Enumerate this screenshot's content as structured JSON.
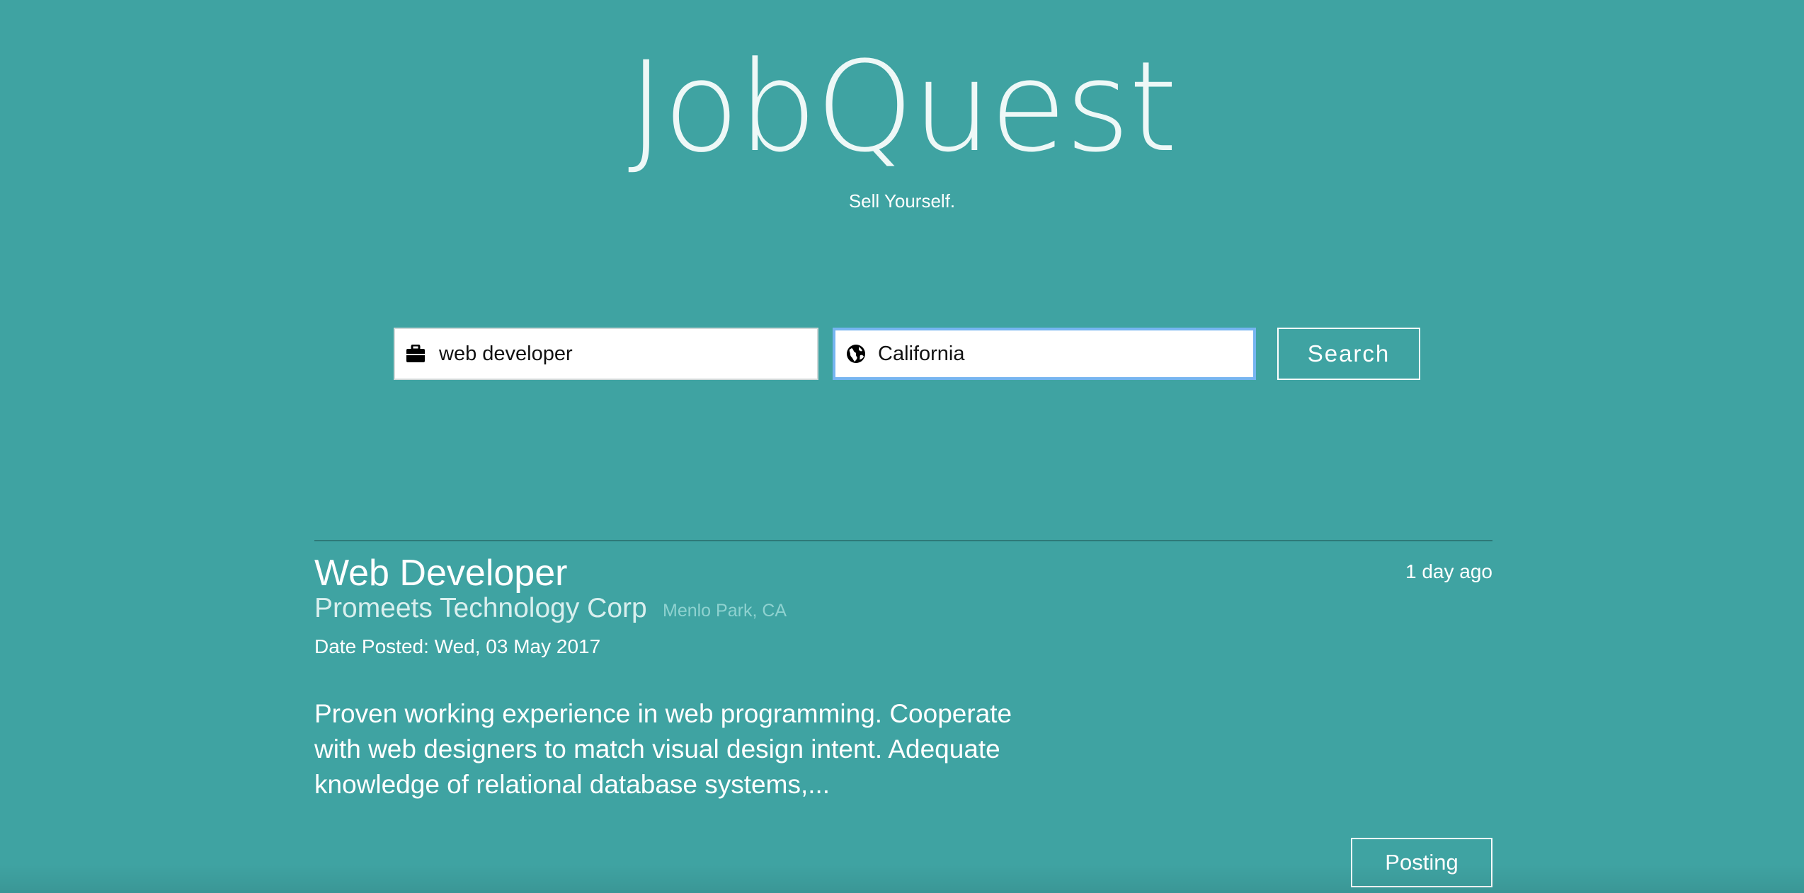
{
  "header": {
    "logo": "JobQuest",
    "tagline": "Sell Yourself."
  },
  "search": {
    "what_value": "web developer",
    "what_icon": "briefcase-icon",
    "where_value": "California",
    "where_icon": "globe-icon",
    "button_label": "Search"
  },
  "results": [
    {
      "title": "Web Developer",
      "posted_ago": "1 day ago",
      "company": "Promeets Technology Corp",
      "location": "Menlo Park, CA",
      "date_posted": "Date Posted: Wed, 03 May 2017",
      "description": "Proven working experience in web programming. Cooperate with web designers to match visual design intent. Adequate knowledge of relational database systems,...",
      "button_label": "Posting"
    }
  ],
  "colors": {
    "background": "#3fa3a2",
    "focus_border": "#76b5f0",
    "divider": "#2d7978"
  }
}
